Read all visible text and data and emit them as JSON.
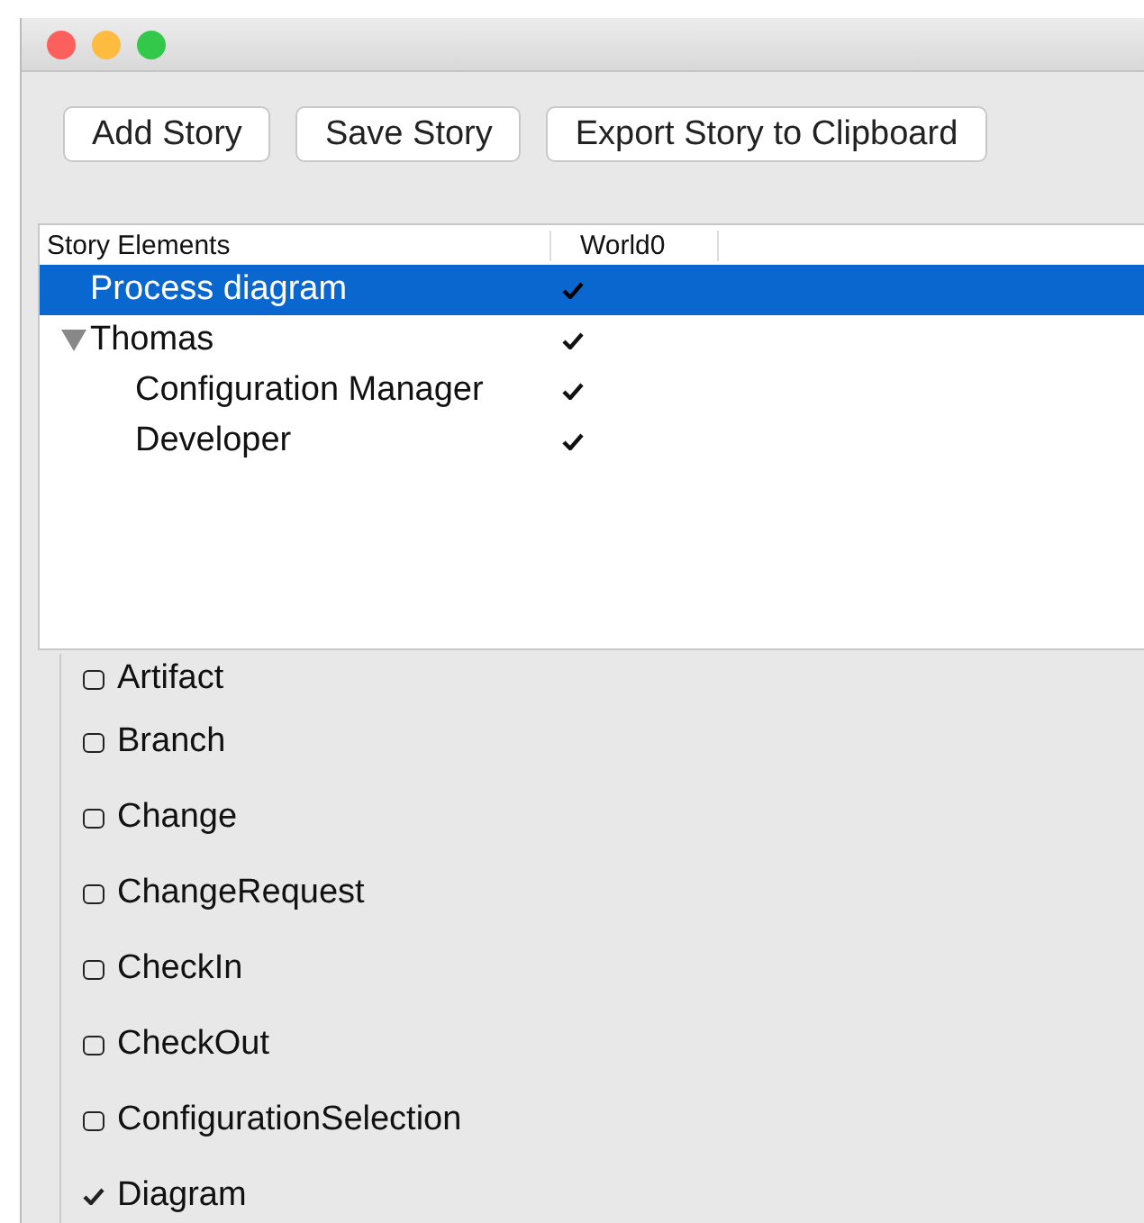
{
  "toolbar": {
    "buttons": [
      "Add Story",
      "Save Story",
      "Export Story to Clipboard"
    ]
  },
  "tree": {
    "columns": [
      "Story Elements",
      "World0"
    ],
    "rows": [
      {
        "label": "Process diagram",
        "selected": true,
        "in_world": true
      },
      {
        "label": "Thomas",
        "selected": false,
        "in_world": true,
        "expanded": true,
        "children": [
          {
            "label": "Configuration Manager",
            "selected": false,
            "in_world": true
          },
          {
            "label": "Developer",
            "selected": false,
            "in_world": true
          }
        ]
      }
    ]
  },
  "element_types": [
    {
      "label": "Artifact",
      "checked": false
    },
    {
      "label": "Branch",
      "checked": false
    },
    {
      "label": "Change",
      "checked": false
    },
    {
      "label": "ChangeRequest",
      "checked": false
    },
    {
      "label": "CheckIn",
      "checked": false
    },
    {
      "label": "CheckOut",
      "checked": false
    },
    {
      "label": "ConfigurationSelection",
      "checked": false
    },
    {
      "label": "Diagram",
      "checked": true
    }
  ]
}
